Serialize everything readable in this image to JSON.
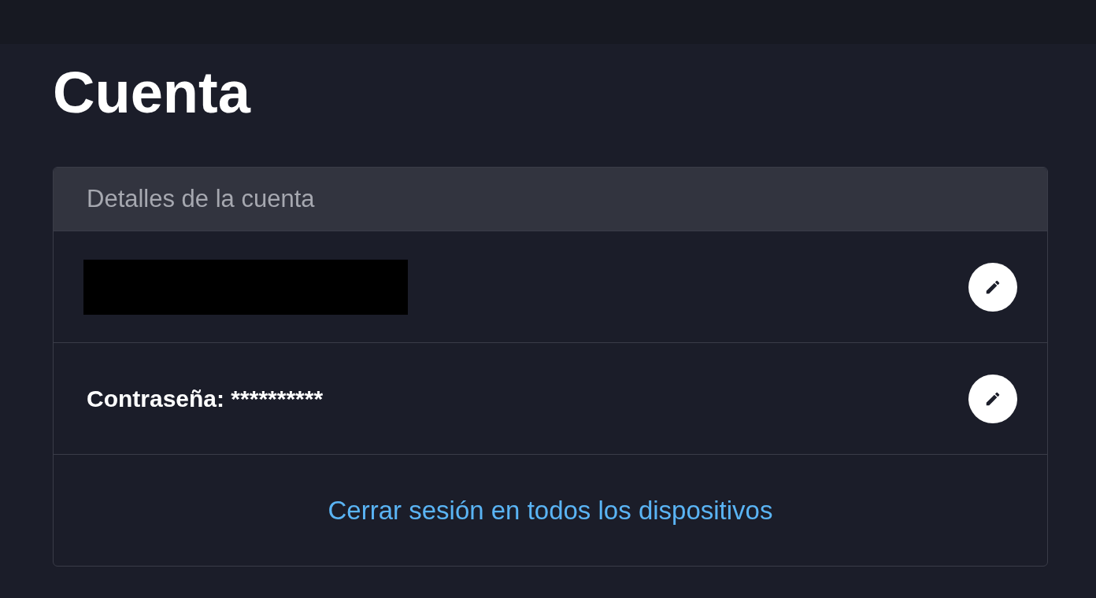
{
  "title": "Cuenta",
  "card": {
    "header": "Detalles de la cuenta",
    "rows": [
      {
        "kind": "redacted",
        "editable": true
      },
      {
        "kind": "field",
        "text": "Contraseña: **********",
        "editable": true
      },
      {
        "kind": "link",
        "text": "Cerrar sesión en todos los dispositivos",
        "editable": false
      }
    ]
  }
}
